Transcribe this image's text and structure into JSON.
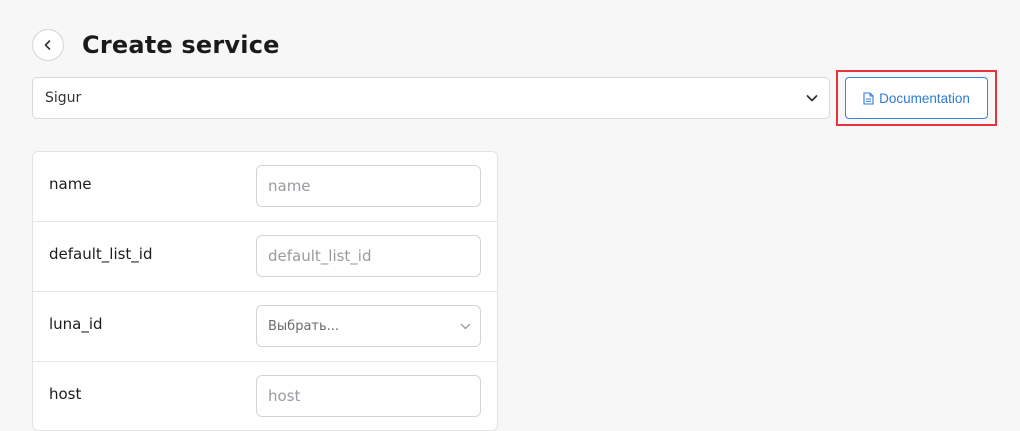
{
  "header": {
    "title": "Create service",
    "back_icon": "chevron-left-icon"
  },
  "service_select": {
    "value": "Sigur",
    "icon": "chevron-down-icon"
  },
  "documentation_button": {
    "label": "Documentation",
    "icon": "document-icon",
    "color": "#2f7bd6"
  },
  "highlight_color": "#e5343b",
  "form": {
    "rows": [
      {
        "label": "name",
        "placeholder": "name",
        "type": "input"
      },
      {
        "label": "default_list_id",
        "placeholder": "default_list_id",
        "type": "input"
      },
      {
        "label": "luna_id",
        "placeholder": "Выбрать...",
        "type": "select"
      },
      {
        "label": "host",
        "placeholder": "host",
        "type": "input"
      }
    ]
  }
}
